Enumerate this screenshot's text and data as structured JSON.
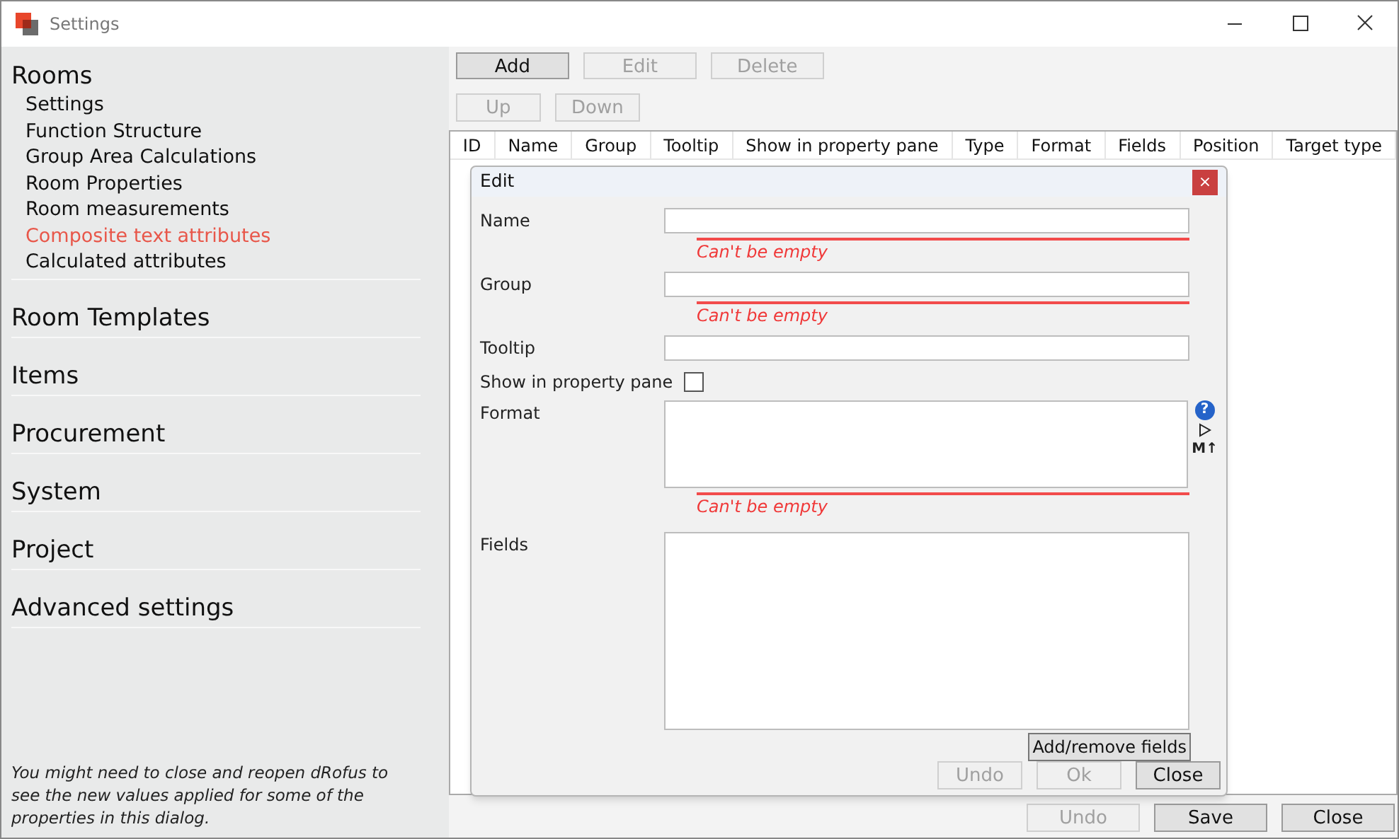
{
  "window": {
    "title": "Settings"
  },
  "sidebar": {
    "sections": [
      {
        "label": "Rooms",
        "items": [
          {
            "label": "Settings",
            "selected": false
          },
          {
            "label": "Function Structure",
            "selected": false
          },
          {
            "label": "Group Area Calculations",
            "selected": false
          },
          {
            "label": "Room Properties",
            "selected": false
          },
          {
            "label": "Room measurements",
            "selected": false
          },
          {
            "label": "Composite text attributes",
            "selected": true
          },
          {
            "label": "Calculated attributes",
            "selected": false
          }
        ]
      },
      {
        "label": "Room Templates"
      },
      {
        "label": "Items"
      },
      {
        "label": "Procurement"
      },
      {
        "label": "System"
      },
      {
        "label": "Project"
      },
      {
        "label": "Advanced settings"
      }
    ],
    "note": "You might need to close and reopen dRofus to see the new values applied for some of the properties in this dialog."
  },
  "toolbar": {
    "rows": [
      [
        {
          "label": "Add",
          "disabled": false
        },
        {
          "label": "Edit",
          "disabled": true
        },
        {
          "label": "Delete",
          "disabled": true
        }
      ],
      [
        {
          "label": "Up",
          "disabled": true
        },
        {
          "label": "Down",
          "disabled": true
        }
      ]
    ]
  },
  "table": {
    "columns": [
      "ID",
      "Name",
      "Group",
      "Tooltip",
      "Show in property pane",
      "Type",
      "Format",
      "Fields",
      "Position",
      "Target type"
    ]
  },
  "footer_buttons": [
    {
      "label": "Undo",
      "disabled": true
    },
    {
      "label": "Save",
      "disabled": false
    },
    {
      "label": "Close",
      "disabled": false
    }
  ],
  "dialog": {
    "title": "Edit",
    "close": "×",
    "fields": [
      {
        "kind": "text",
        "label": "Name",
        "error": "Can't be empty"
      },
      {
        "kind": "text",
        "label": "Group",
        "error": "Can't be empty"
      },
      {
        "kind": "text",
        "label": "Tooltip"
      },
      {
        "kind": "checkbox",
        "label": "Show in property pane",
        "checked": false
      },
      {
        "kind": "textarea",
        "label": "Format",
        "error": "Can't be empty",
        "help": "?",
        "tools": "M↑"
      },
      {
        "kind": "list",
        "label": "Fields",
        "button": "Add/remove fields"
      }
    ],
    "buttons": [
      {
        "label": "Undo",
        "disabled": true
      },
      {
        "label": "Ok",
        "disabled": true
      },
      {
        "label": "Close",
        "disabled": false
      }
    ]
  }
}
